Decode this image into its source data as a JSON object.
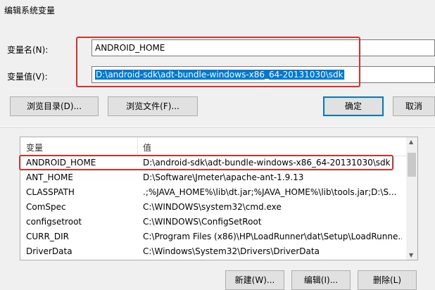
{
  "dialog": {
    "title": "编辑系统变量",
    "name_label": "变量名(N):",
    "name_value": "ANDROID_HOME",
    "value_label": "变量值(V):",
    "value_value": "D:\\android-sdk\\adt-bundle-windows-x86_64-20131030\\sdk",
    "browse_dir_label": "浏览目录(D)...",
    "browse_file_label": "浏览文件(F)...",
    "ok_label": "确定",
    "cancel_label": "取消"
  },
  "list": {
    "columns": [
      "变量",
      "值"
    ],
    "rows": [
      {
        "name": "ANDROID_HOME",
        "value": "D:\\android-sdk\\adt-bundle-windows-x86_64-20131030\\sdk"
      },
      {
        "name": "ANT_HOME",
        "value": "D:\\Software\\Jmeter\\apache-ant-1.9.13"
      },
      {
        "name": "CLASSPATH",
        "value": ".;%JAVA_HOME%\\lib\\dt.jar;%JAVA_HOME%\\lib\\tools.jar;D:\\S..."
      },
      {
        "name": "ComSpec",
        "value": "C:\\WINDOWS\\system32\\cmd.exe"
      },
      {
        "name": "configsetroot",
        "value": "C:\\WINDOWS\\ConfigSetRoot"
      },
      {
        "name": "CURR_DIR",
        "value": "C:\\Program Files (x86)\\HP\\LoadRunner\\dat\\Setup\\LoadRunne..."
      },
      {
        "name": "DriverData",
        "value": "C:\\Windows\\System32\\Drivers\\DriverData"
      }
    ]
  },
  "bottom_buttons": {
    "new_label": "新建(W)...",
    "edit_label": "编辑(I)...",
    "delete_label": "删除(L)"
  },
  "colors": {
    "highlight": "#d9302c",
    "selection": "#0078d7"
  }
}
